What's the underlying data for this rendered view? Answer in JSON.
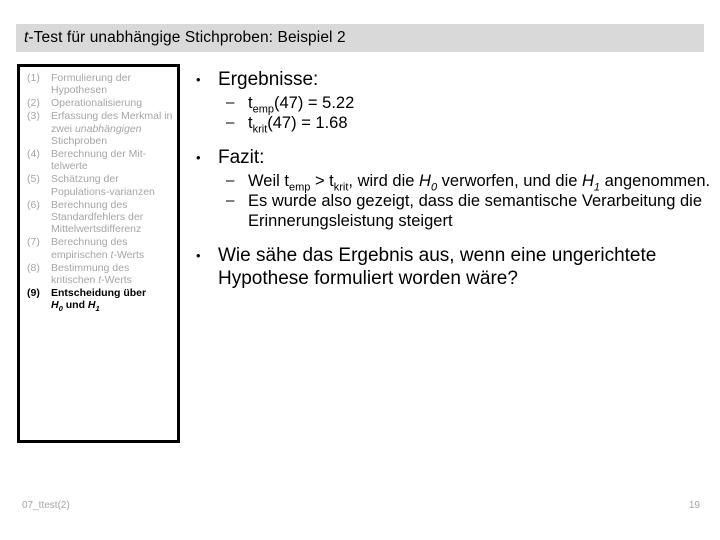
{
  "slide": {
    "title_prefix_italic": "t",
    "title_rest": "-Test für unabhängige Stichproben: Beispiel 2",
    "title_full": "t-Test für unabhängige Stichproben: Beispiel 2"
  },
  "steps_box": {
    "items": [
      {
        "num": "(1)",
        "text": "Formulierung der Hypothesen",
        "active": false
      },
      {
        "num": "(2)",
        "text": "Operationalisierung",
        "active": false
      },
      {
        "num": "(3)",
        "text_part1": "Erfassung des Merkmal in zwei ",
        "text_italic": "unabhängigen",
        "text_part2": " Stichproben",
        "active": false
      },
      {
        "num": "(4)",
        "text": "Berechnung der Mit-telwerte",
        "active": false
      },
      {
        "num": "(5)",
        "text": "Schätzung der Populations-varianzen",
        "active": false
      },
      {
        "num": "(6)",
        "text": "Berechnung des Standardfehlers der Mittelwertsdifferenz",
        "active": false
      },
      {
        "num": "(7)",
        "text_part1": "Berechnung des empirischen ",
        "text_italic": "t",
        "text_part2": "-Werts",
        "active": false
      },
      {
        "num": "(8)",
        "text_part1": "Bestimmung des kritischen ",
        "text_italic": "t",
        "text_part2": "-Werts",
        "active": false
      },
      {
        "num": "(9)",
        "text_line1": "Entscheidung über",
        "h0": "H",
        "h0_sub": "0",
        "conj": " und ",
        "h1": "H",
        "h1_sub": "1",
        "active": true
      }
    ]
  },
  "content": {
    "bullet_glyph": "•",
    "dash_glyph": "–",
    "block_results": {
      "heading": "Ergebnisse:",
      "lines": [
        {
          "var": "t",
          "sub": "emp",
          "rest": "(47) = 5.22"
        },
        {
          "var": "t",
          "sub": "krit",
          "rest": "(47) = 1.68"
        }
      ]
    },
    "block_conclusion": {
      "heading": "Fazit:",
      "line1_a": "Weil t",
      "line1_sub1": "emp",
      "line1_b": " > t",
      "line1_sub2": "krit",
      "line1_c": ", wird die ",
      "line1_h0": "H",
      "line1_h0_sub": "0",
      "line1_d": " verworfen, und die ",
      "line1_h1": "H",
      "line1_h1_sub": "1",
      "line1_e": " angenommen.",
      "line2": "Es wurde also gezeigt, dass die semantische Verarbeitung die Erinnerungsleistung steigert"
    },
    "block_question": {
      "text": "Wie sähe das Ergebnis aus, wenn eine ungerichtete Hypothese formuliert worden wäre?"
    }
  },
  "footer": {
    "file_label": "07_ttest(2)",
    "slide_number": "19"
  },
  "colors": {
    "title_bar_bg": "#d9d9d9",
    "muted_text": "#a6a6a6",
    "active_text": "#000000",
    "box_border": "#000000"
  }
}
